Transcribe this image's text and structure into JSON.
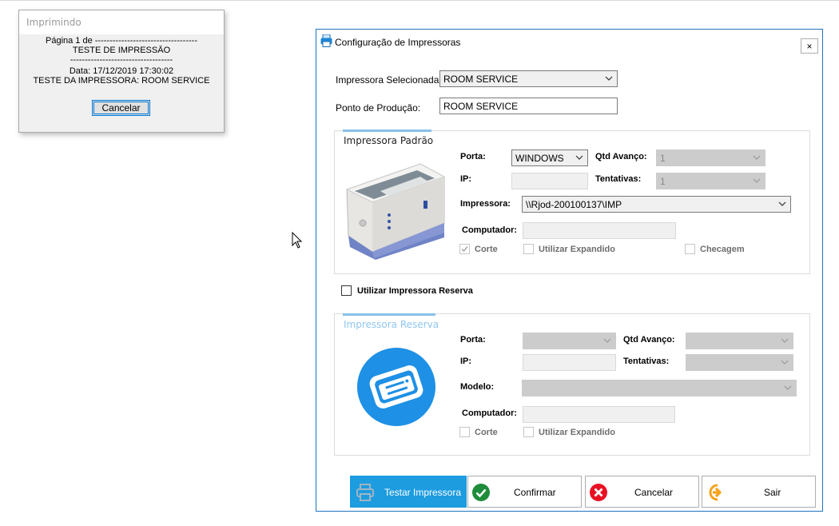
{
  "print_dialog": {
    "title": "Imprimindo",
    "lines": [
      "Página 1 de -----------------------------------",
      "TESTE DE IMPRESSÃO",
      "-----------------------------------",
      "Data: 17/12/2019 17:30:02",
      "TESTE DA IMPRESSORA: ROOM SERVICE"
    ],
    "cancel_label": "Cancelar"
  },
  "config_dialog": {
    "title": "Configuração de Impressoras",
    "close_label": "×",
    "selected_printer": {
      "label": "Impressora Selecionada:",
      "value": "ROOM SERVICE"
    },
    "production_point": {
      "label": "Ponto de Produção:",
      "value": "ROOM SERVICE"
    },
    "default_group": {
      "title": "Impressora Padrão",
      "porta": {
        "label": "Porta:",
        "value": "WINDOWS"
      },
      "qtd_avanco": {
        "label": "Qtd Avanço:",
        "value": "1"
      },
      "ip": {
        "label": "IP:",
        "value": ""
      },
      "tentativas": {
        "label": "Tentativas:",
        "value": "1"
      },
      "impressora": {
        "label": "Impressora:",
        "value": "\\\\Rjod-200100137\\IMP"
      },
      "computador": {
        "label": "Computador:",
        "value": ""
      },
      "corte": {
        "label": "Corte",
        "checked": true
      },
      "utilizar_expandido": {
        "label": "Utilizar Expandido",
        "checked": false
      },
      "checagem": {
        "label": "Checagem",
        "checked": false
      }
    },
    "use_backup": {
      "label": "Utilizar Impressora Reserva",
      "checked": false
    },
    "backup_group": {
      "title": "Impressora Reserva",
      "porta": {
        "label": "Porta:",
        "value": ""
      },
      "qtd_avanco": {
        "label": "Qtd Avanço:",
        "value": ""
      },
      "ip": {
        "label": "IP:",
        "value": ""
      },
      "tentativas": {
        "label": "Tentativas:",
        "value": ""
      },
      "modelo": {
        "label": "Modelo:",
        "value": ""
      },
      "computador": {
        "label": "Computador:",
        "value": ""
      },
      "corte": {
        "label": "Corte",
        "checked": false
      },
      "utilizar_expandido": {
        "label": "Utilizar Expandido",
        "checked": false
      }
    },
    "buttons": {
      "test": "Testar Impressora",
      "confirm": "Confirmar",
      "cancel": "Cancelar",
      "exit": "Sair"
    }
  },
  "colors": {
    "accent": "#1d9ce0",
    "window_border": "#1e73be",
    "confirm_icon": "#1e8c3a",
    "cancel_icon": "#e81123",
    "exit_icon": "#f4a31c"
  },
  "icons": [
    "printer-app-icon",
    "printer-photo-icon",
    "receipt-printer-icon",
    "printer-icon",
    "check-circle-icon",
    "cancel-circle-icon",
    "exit-icon",
    "chevron-down-icon",
    "close-icon",
    "mouse-cursor-icon"
  ]
}
